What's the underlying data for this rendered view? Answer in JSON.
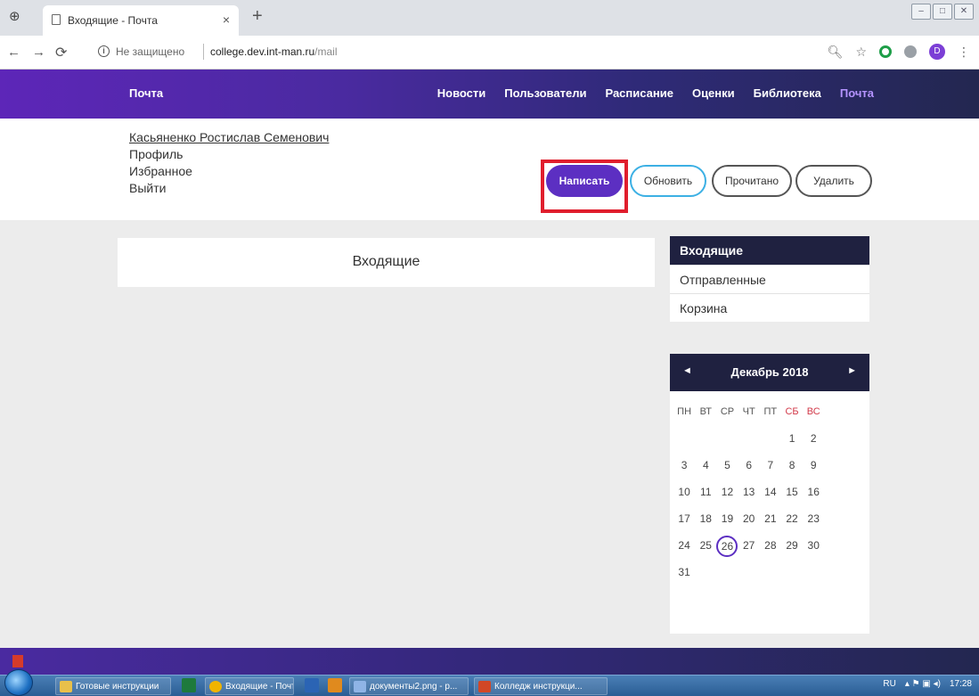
{
  "browser": {
    "tab_title": "Входящие - Почта",
    "tab_close": "×",
    "new_tab": "+",
    "security": "Не защищено",
    "url_host": "college.dev.int-man.ru",
    "url_path": "/mail",
    "profile_letter": "D"
  },
  "site": {
    "brand": "Почта",
    "menu": [
      {
        "label": "Новости"
      },
      {
        "label": "Пользователи"
      },
      {
        "label": "Расписание"
      },
      {
        "label": "Оценки"
      },
      {
        "label": "Библиотека"
      },
      {
        "label": "Почта",
        "active": true
      }
    ],
    "accent_color": "#5c2fc2",
    "highlight_color": "#e01e2d"
  },
  "user": {
    "name": "Касьяненко Ростислав Семенович",
    "links": [
      "Профиль",
      "Избранное",
      "Выйти"
    ]
  },
  "actions": {
    "compose": "Написать",
    "refresh": "Обновить",
    "mark_read": "Прочитано",
    "delete": "Удалить"
  },
  "inbox": {
    "title": "Входящие"
  },
  "folders": [
    {
      "label": "Входящие",
      "active": true
    },
    {
      "label": "Отправленные"
    },
    {
      "label": "Корзина"
    }
  ],
  "calendar": {
    "month": "Декабрь 2018",
    "prev": "◄",
    "next": "►",
    "weekdays": [
      "ПН",
      "ВТ",
      "СР",
      "ЧТ",
      "ПТ",
      "СБ",
      "ВС"
    ],
    "weeks": [
      [
        "",
        "",
        "",
        "",
        "",
        "1",
        "2"
      ],
      [
        "3",
        "4",
        "5",
        "6",
        "7",
        "8",
        "9"
      ],
      [
        "10",
        "11",
        "12",
        "13",
        "14",
        "15",
        "16"
      ],
      [
        "17",
        "18",
        "19",
        "20",
        "21",
        "22",
        "23"
      ],
      [
        "24",
        "25",
        "26",
        "27",
        "28",
        "29",
        "30"
      ],
      [
        "31",
        "",
        "",
        "",
        "",
        "",
        ""
      ]
    ],
    "today": "26"
  },
  "taskbar": {
    "items": [
      {
        "label": "Готовые инструкции",
        "icon": "folder-icon"
      },
      {
        "label": "Входящие - Почта ...",
        "icon": "chrome-icon"
      },
      {
        "label": "документы2.png - p...",
        "icon": "paint-icon"
      },
      {
        "label": "Колледж инструкци...",
        "icon": "powerpoint-icon"
      }
    ],
    "lang": "RU",
    "time": "17:28"
  }
}
